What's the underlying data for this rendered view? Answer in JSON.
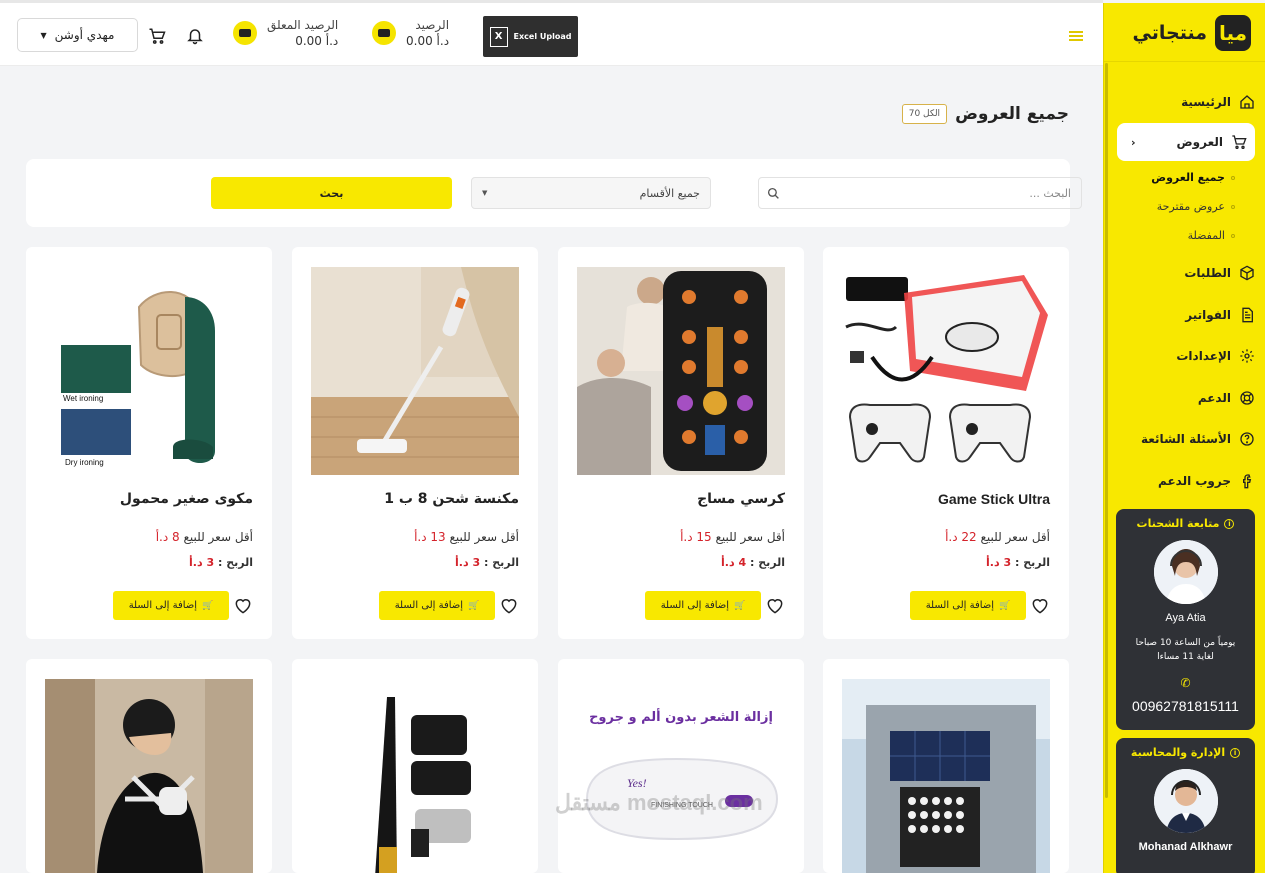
{
  "header": {
    "user_name": "مهدي أوشن",
    "suspended_balance_label": "الرصيد المعلق",
    "suspended_balance_value": "0.00 د.أ",
    "balance_label": "الرصيد",
    "balance_value": "0.00 د.أ",
    "excel_label": "Excel Upload"
  },
  "brand": {
    "name": "منتجاتي",
    "logo_text": "ميا"
  },
  "sidebar": {
    "items": [
      {
        "label": "الرئيسية",
        "icon": "home-icon"
      },
      {
        "label": "العروض",
        "icon": "cart-icon"
      },
      {
        "label": "الطلبات",
        "icon": "box-icon"
      },
      {
        "label": "الفواتير",
        "icon": "invoice-icon"
      },
      {
        "label": "الإعدادات",
        "icon": "gear-icon"
      },
      {
        "label": "الدعم",
        "icon": "lifebuoy-icon"
      },
      {
        "label": "الأسئلة الشائعة",
        "icon": "question-icon"
      },
      {
        "label": "جروب الدعم",
        "icon": "facebook-icon"
      }
    ],
    "subitems": [
      "جميع العروض",
      "عروض مقترحة",
      "المفضلة"
    ],
    "shipping_card": {
      "title": "متابعة الشحنات",
      "name": "Aya Atia",
      "hours_line1": "يومياً من الساعة 10 صباحا",
      "hours_line2": "لغاية 11 مساءا",
      "phone": "00962781815111"
    },
    "admin_card": {
      "title": "الإدارة والمحاسبة",
      "name": "Mohanad Alkhawr"
    }
  },
  "main": {
    "title": "جميع العروض",
    "count_badge": "الكل 70",
    "search_placeholder": "البحث ...",
    "category_value": "جميع الأقسام",
    "search_button": "بحث"
  },
  "products": [
    {
      "name": "Game Stick Ultra",
      "price_label": "أقل سعر للبيع",
      "price": "22 د.أ",
      "profit_label": "الربح :",
      "profit": "3 د.أ",
      "add_label": "إضافة إلى السلة"
    },
    {
      "name": "كرسي مساج",
      "price_label": "أقل سعر للبيع",
      "price": "15 د.أ",
      "profit_label": "الربح :",
      "profit": "4 د.أ",
      "add_label": "إضافة إلى السلة"
    },
    {
      "name": "مكنسة شحن 8 ب 1",
      "price_label": "أقل سعر للبيع",
      "price": "13 د.أ",
      "profit_label": "الربح :",
      "profit": "3 د.أ",
      "add_label": "إضافة إلى السلة"
    },
    {
      "name": "مكوى صغير محمول",
      "price_label": "أقل سعر للبيع",
      "price": "8 د.أ",
      "profit_label": "الربح :",
      "profit": "3 د.أ",
      "add_label": "إضافة إلى السلة"
    }
  ],
  "product_images": {
    "iron_text1": "Wet ironing",
    "iron_text2": "Dry ironing",
    "hair_text": "إزالة الشعر بدون ألم و جروح",
    "hair_brand": "Yes!",
    "hair_sub": "FINISHING TOUCH"
  },
  "watermark": "مستقل mostaql.com"
}
